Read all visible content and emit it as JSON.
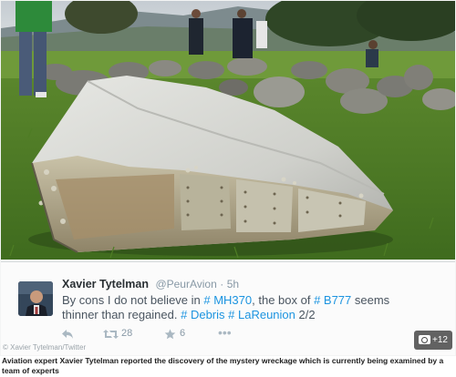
{
  "photo": {
    "alt_icon": "wreckage-photo"
  },
  "tweet": {
    "author_name": "Xavier Tytelman",
    "handle": "@PeurAvion",
    "separator": "·",
    "time": "5h",
    "text_parts": {
      "p1": "By cons I do not believe in ",
      "tag1": "# MH370",
      "p2": ", the box of ",
      "tag2": "# B777",
      "p3": " seems thinner than regained. ",
      "tag3": "# Debris",
      "p4": " ",
      "tag4": "# LaReunion",
      "p5": " 2/2"
    },
    "retweet_count": "28",
    "favorite_count": "6",
    "colors": {
      "hashtag": "#1c94e0",
      "text": "#4a5560",
      "muted": "#8899a6"
    }
  },
  "photo_count": "+12",
  "credit": "© Xavier Tytelman/Twitter",
  "caption": "Aviation expert Xavier Tytelman reported the discovery of the mystery wreckage which is currently being examined by a team of experts"
}
